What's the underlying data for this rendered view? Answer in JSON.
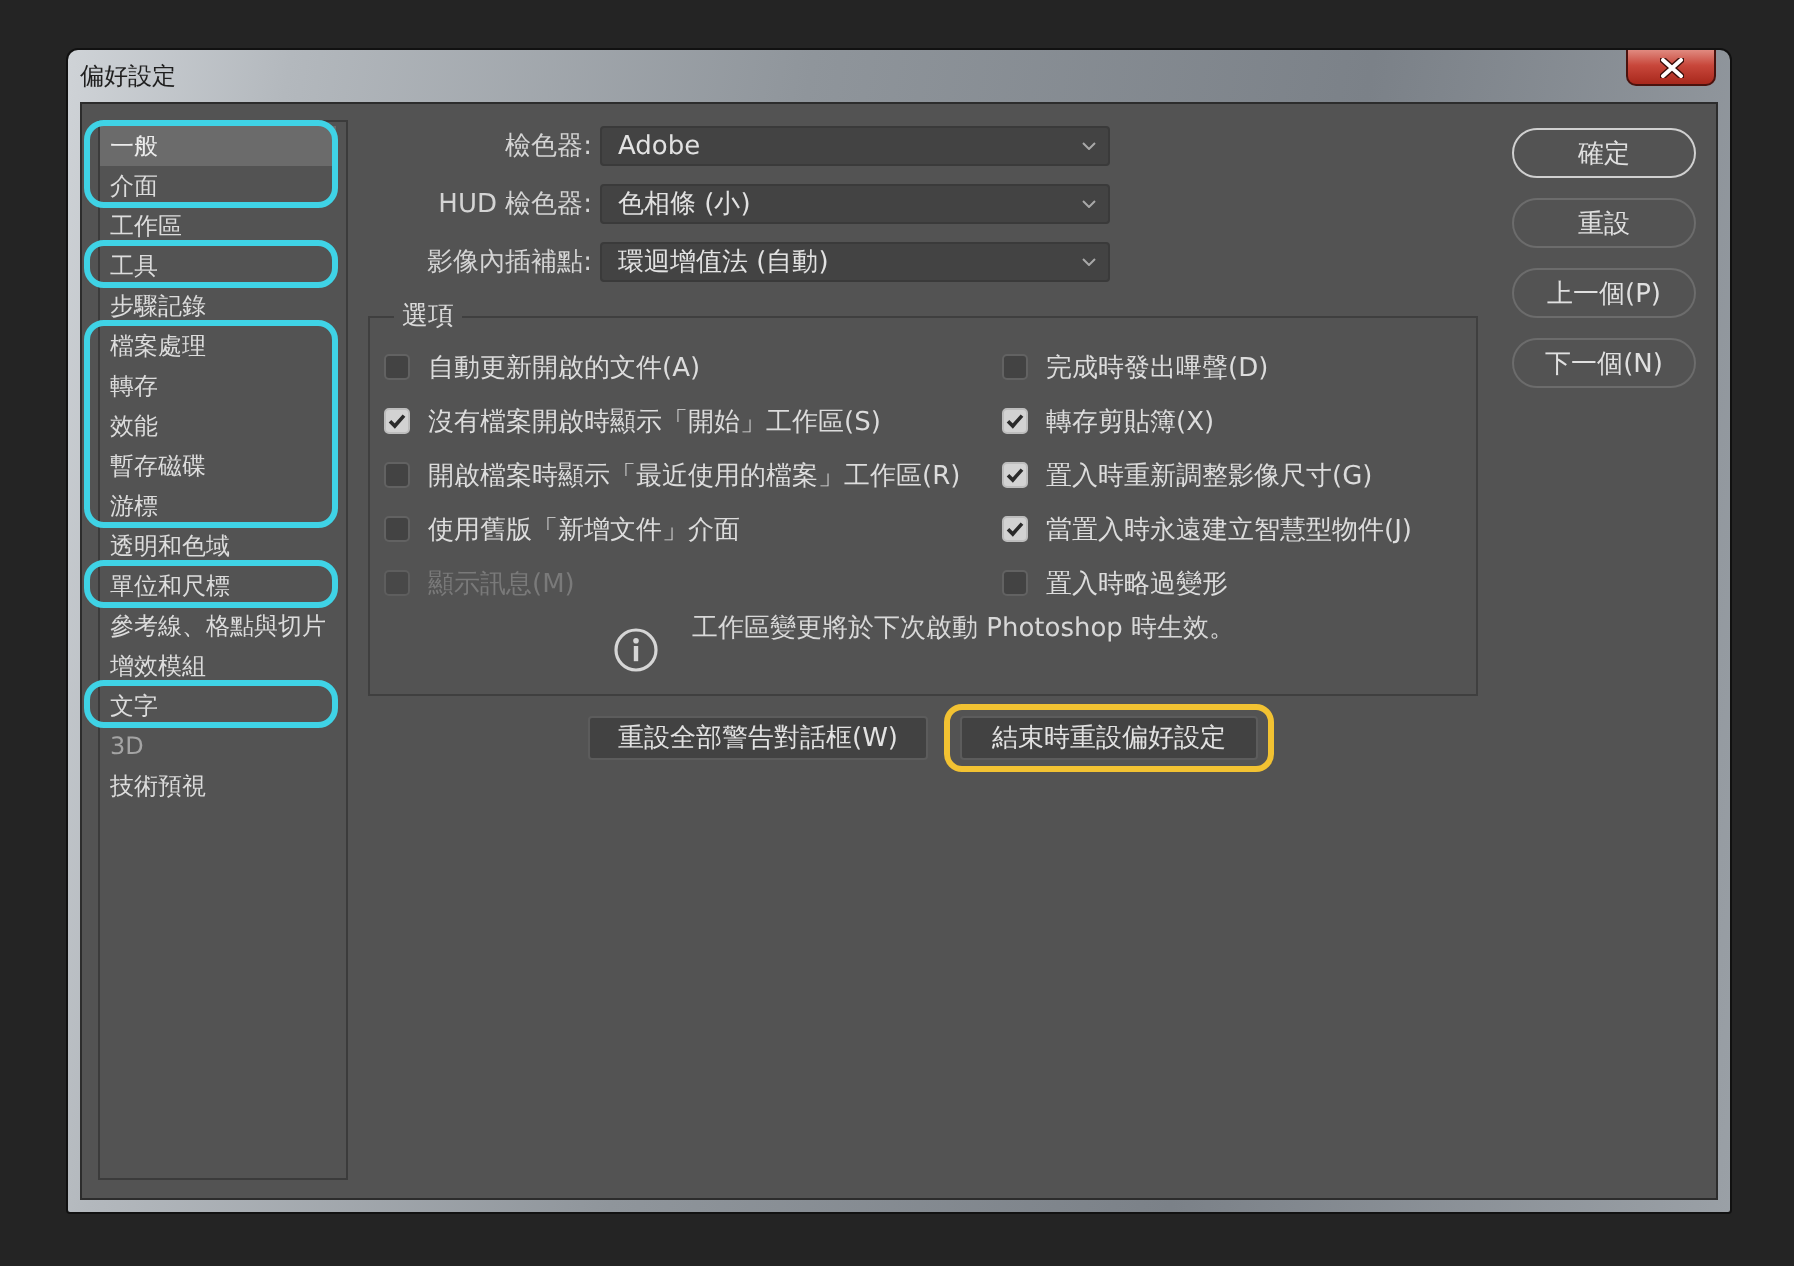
{
  "window": {
    "title": "偏好設定"
  },
  "sidebar": {
    "groups": [
      {
        "highlighted": true,
        "items": [
          {
            "label": "一般",
            "selected": true,
            "disabled": false
          },
          {
            "label": "介面",
            "selected": false,
            "disabled": false
          }
        ]
      },
      {
        "highlighted": false,
        "items": [
          {
            "label": "工作區",
            "selected": false,
            "disabled": false
          }
        ]
      },
      {
        "highlighted": true,
        "items": [
          {
            "label": "工具",
            "selected": false,
            "disabled": false
          }
        ]
      },
      {
        "highlighted": false,
        "items": [
          {
            "label": "步驟記錄",
            "selected": false,
            "disabled": false
          }
        ]
      },
      {
        "highlighted": true,
        "items": [
          {
            "label": "檔案處理",
            "selected": false,
            "disabled": false
          },
          {
            "label": "轉存",
            "selected": false,
            "disabled": false
          },
          {
            "label": "效能",
            "selected": false,
            "disabled": false
          },
          {
            "label": "暫存磁碟",
            "selected": false,
            "disabled": false
          },
          {
            "label": "游標",
            "selected": false,
            "disabled": false
          }
        ]
      },
      {
        "highlighted": false,
        "items": [
          {
            "label": "透明和色域",
            "selected": false,
            "disabled": false
          }
        ]
      },
      {
        "highlighted": true,
        "items": [
          {
            "label": "單位和尺標",
            "selected": false,
            "disabled": false
          }
        ]
      },
      {
        "highlighted": false,
        "items": [
          {
            "label": "參考線、格點與切片",
            "selected": false,
            "disabled": false
          },
          {
            "label": "增效模組",
            "selected": false,
            "disabled": false
          }
        ]
      },
      {
        "highlighted": true,
        "items": [
          {
            "label": "文字",
            "selected": false,
            "disabled": false
          }
        ]
      },
      {
        "highlighted": false,
        "items": [
          {
            "label": "3D",
            "selected": false,
            "disabled": true
          },
          {
            "label": "技術預視",
            "selected": false,
            "disabled": false
          }
        ]
      }
    ]
  },
  "dropdowns": [
    {
      "label": "檢色器:",
      "value": "Adobe"
    },
    {
      "label": "HUD 檢色器:",
      "value": "色相條 (小)"
    },
    {
      "label": "影像內插補點:",
      "value": "環迴增值法 (自動)"
    }
  ],
  "options": {
    "title": "選項",
    "left_column": [
      {
        "label": "自動更新開啟的文件(A)",
        "checked": false,
        "disabled": false
      },
      {
        "label": "沒有檔案開啟時顯示「開始」工作區(S)",
        "checked": true,
        "disabled": false
      },
      {
        "label": "開啟檔案時顯示「最近使用的檔案」工作區(R)",
        "checked": false,
        "disabled": false
      },
      {
        "label": "使用舊版「新增文件」介面",
        "checked": false,
        "disabled": false
      },
      {
        "label": "顯示訊息(M)",
        "checked": false,
        "disabled": true
      }
    ],
    "right_column": [
      {
        "label": "完成時發出嗶聲(D)",
        "checked": false,
        "disabled": false
      },
      {
        "label": "轉存剪貼簿(X)",
        "checked": true,
        "disabled": false
      },
      {
        "label": "置入時重新調整影像尺寸(G)",
        "checked": true,
        "disabled": false
      },
      {
        "label": "當置入時永遠建立智慧型物件(J)",
        "checked": true,
        "disabled": false
      },
      {
        "label": "置入時略過變形",
        "checked": false,
        "disabled": false
      }
    ],
    "notice": "工作區變更將於下次啟動 Photoshop 時生效。"
  },
  "bottom_buttons": [
    {
      "label": "重設全部警告對話框(W)",
      "highlighted": false
    },
    {
      "label": "結束時重設偏好設定",
      "highlighted": true
    }
  ],
  "side_buttons": [
    {
      "label": "確定",
      "default": true
    },
    {
      "label": "重設",
      "default": false
    },
    {
      "label": "上一個(P)",
      "default": false
    },
    {
      "label": "下一個(N)",
      "default": false
    }
  ]
}
